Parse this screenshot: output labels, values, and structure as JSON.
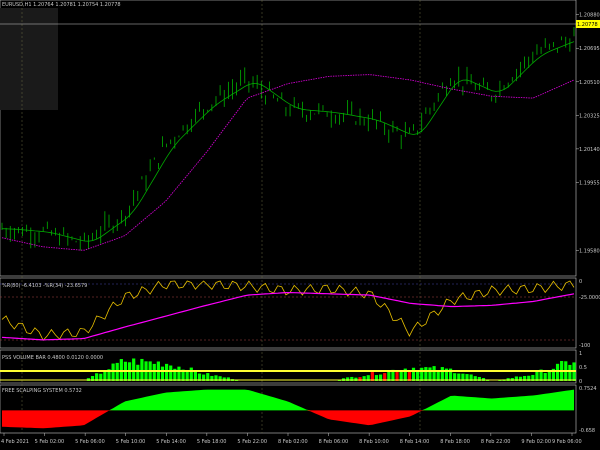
{
  "window": {
    "title": "EURUSD,H1 1.20764 1.20781 1.20754 1.20778"
  },
  "colors": {
    "background": "#000000",
    "grid": "#5a5a3a",
    "frame": "#c8c8c8",
    "candles": "#00cc00",
    "ma_slow": "#cc00cc",
    "ma_fast": "#00aa00",
    "wpr_line": "#e8c000",
    "wpr_signal": "#ff00ff",
    "level_line": "#ffff33",
    "hist_bull": "#00ff00",
    "hist_bear": "#ff0000",
    "price_tag": "#ffff00"
  },
  "price_panel": {
    "current_price": "1.20778",
    "scale": [
      "1.20880",
      "1.20695",
      "1.20510",
      "1.20325",
      "1.20140",
      "1.19955",
      "1.19580"
    ],
    "ylim": [
      1.1945,
      1.2095
    ]
  },
  "wpr_panel": {
    "header": "%R(80) -6.4103  -%R(34) -23.6579",
    "scale": [
      "0",
      "-25.0000",
      "-100"
    ],
    "ylim": [
      -100,
      0
    ]
  },
  "volume_panel": {
    "header": "PSS VOLUME BAR 0.4800 0.0120 0.0000",
    "scale": [
      "1",
      "0.5",
      "0"
    ],
    "ylim": [
      0,
      1
    ]
  },
  "scalping_panel": {
    "header": "FREE SCALPING SYSTEM 0.5732",
    "scale": [
      "0.7524",
      "-0.658"
    ],
    "ylim": [
      -0.658,
      0.7524
    ]
  },
  "time_axis": [
    "4 Feb 2021",
    "5 Feb 02:00",
    "5 Feb 06:00",
    "5 Feb 10:00",
    "5 Feb 14:00",
    "5 Feb 18:00",
    "5 Feb 22:00",
    "8 Feb 02:00",
    "8 Feb 06:00",
    "8 Feb 10:00",
    "8 Feb 14:00",
    "8 Feb 18:00",
    "8 Feb 22:00",
    "9 Feb 02:00",
    "9 Feb 06:00"
  ],
  "chart_data": {
    "type": "line",
    "title": "EURUSD,H1",
    "x": [
      "4 Feb 2021",
      "5 Feb 02:00",
      "5 Feb 06:00",
      "5 Feb 10:00",
      "5 Feb 14:00",
      "5 Feb 18:00",
      "5 Feb 22:00",
      "8 Feb 02:00",
      "8 Feb 06:00",
      "8 Feb 10:00",
      "8 Feb 14:00",
      "8 Feb 18:00",
      "8 Feb 22:00",
      "9 Feb 02:00",
      "9 Feb 06:00"
    ],
    "series": [
      {
        "values": [
          1.197,
          1.1968,
          1.1962,
          1.1978,
          1.2016,
          1.2038,
          1.2052,
          1.2036,
          1.2034,
          1.203,
          1.202,
          1.2054,
          1.2044,
          1.2066,
          1.2075
        ]
      },
      {
        "values": [
          1.1965,
          1.196,
          1.1958,
          1.1966,
          1.1985,
          1.2012,
          1.2042,
          1.205,
          1.2054,
          1.2055,
          1.2052,
          1.2047,
          1.2043,
          1.2042,
          1.2052
        ]
      },
      {
        "values": [
          -60,
          -85,
          -80,
          -25,
          -5,
          -5,
          -8,
          -15,
          -12,
          -20,
          -80,
          -30,
          -15,
          -12,
          -5
        ]
      },
      {
        "values": [
          -88,
          -92,
          -90,
          -72,
          -55,
          -38,
          -22,
          -18,
          -20,
          -22,
          -35,
          -40,
          -38,
          -32,
          -20
        ]
      },
      {
        "values": [
          0,
          0,
          0,
          0.9,
          0.8,
          0.3,
          0,
          0,
          0,
          0.3,
          0.6,
          0.5,
          0,
          0.3,
          0.9
        ]
      },
      {
        "values": [
          -0.55,
          -0.6,
          -0.5,
          0.3,
          0.6,
          0.7,
          0.7,
          0.3,
          -0.3,
          -0.5,
          -0.2,
          0.5,
          0.4,
          0.5,
          0.7
        ]
      }
    ],
    "ylim": [
      1.1945,
      1.2095
    ]
  }
}
